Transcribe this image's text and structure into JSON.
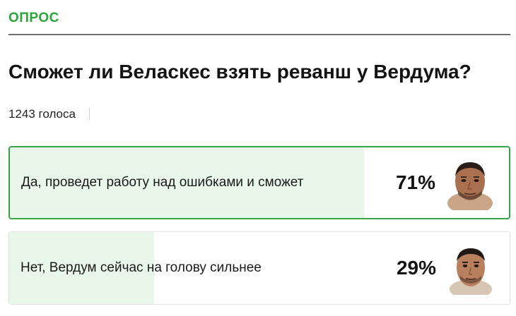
{
  "poll": {
    "label": "ОПРОС",
    "question": "Сможет ли Веласкес взять реванш у Вердума?",
    "votes_text": "1243 голоса",
    "options": [
      {
        "text": "Да, проведет работу над ошибками и сможет",
        "percent_text": "71%",
        "percent": 71,
        "selected": true,
        "avatar_icon": "fighter-velasquez-avatar-icon"
      },
      {
        "text": "Нет, Вердум сейчас на голову сильнее",
        "percent_text": "29%",
        "percent": 29,
        "selected": false,
        "avatar_icon": "fighter-werdum-avatar-icon"
      }
    ]
  },
  "colors": {
    "accent_green": "#2aa63a",
    "selected_border": "#35a545",
    "result_fill": "#e9f6ea",
    "divider": "#6f6f6f"
  }
}
